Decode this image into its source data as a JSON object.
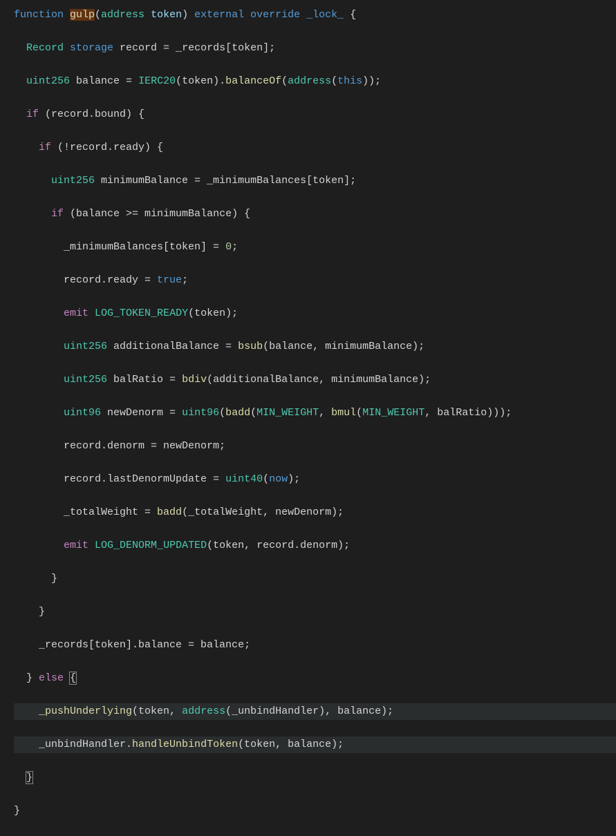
{
  "code": {
    "lines": [
      {
        "indent": 0,
        "tokens": [
          {
            "t": "function ",
            "c": "keyword"
          },
          {
            "t": "gulp",
            "c": "fn-name highlighted"
          },
          {
            "t": "(",
            "c": "paren"
          },
          {
            "t": "address",
            "c": "type"
          },
          {
            "t": " ",
            "c": ""
          },
          {
            "t": "token",
            "c": "variable"
          },
          {
            "t": ") ",
            "c": "paren"
          },
          {
            "t": "external",
            "c": "keyword"
          },
          {
            "t": " ",
            "c": ""
          },
          {
            "t": "override",
            "c": "keyword"
          },
          {
            "t": " ",
            "c": ""
          },
          {
            "t": "_lock_",
            "c": "modifier"
          },
          {
            "t": " {",
            "c": "brace"
          }
        ]
      },
      {
        "indent": 1,
        "tokens": [
          {
            "t": "Record ",
            "c": "type"
          },
          {
            "t": "storage",
            "c": "storage"
          },
          {
            "t": " record = _records[token];",
            "c": "operator"
          }
        ]
      },
      {
        "indent": 1,
        "tokens": [
          {
            "t": "uint256",
            "c": "type"
          },
          {
            "t": " balance = ",
            "c": "operator"
          },
          {
            "t": "IERC20",
            "c": "type"
          },
          {
            "t": "(token).",
            "c": "punct"
          },
          {
            "t": "balanceOf",
            "c": "member"
          },
          {
            "t": "(",
            "c": "paren"
          },
          {
            "t": "address",
            "c": "type"
          },
          {
            "t": "(",
            "c": "paren"
          },
          {
            "t": "this",
            "c": "keyword"
          },
          {
            "t": "));",
            "c": "punct"
          }
        ]
      },
      {
        "indent": 1,
        "tokens": [
          {
            "t": "if",
            "c": "control"
          },
          {
            "t": " (record.bound) {",
            "c": "punct"
          }
        ]
      },
      {
        "indent": 2,
        "tokens": [
          {
            "t": "if",
            "c": "control"
          },
          {
            "t": " (!record.ready) {",
            "c": "punct"
          }
        ]
      },
      {
        "indent": 3,
        "tokens": [
          {
            "t": "uint256",
            "c": "type"
          },
          {
            "t": " minimumBalance = _minimumBalances[token];",
            "c": "operator"
          }
        ]
      },
      {
        "indent": 3,
        "tokens": [
          {
            "t": "if",
            "c": "control"
          },
          {
            "t": " (balance >= minimumBalance) {",
            "c": "punct"
          }
        ]
      },
      {
        "indent": 4,
        "tokens": [
          {
            "t": "_minimumBalances[token] = ",
            "c": "operator"
          },
          {
            "t": "0",
            "c": "number"
          },
          {
            "t": ";",
            "c": "punct"
          }
        ]
      },
      {
        "indent": 4,
        "tokens": [
          {
            "t": "record.ready = ",
            "c": "operator"
          },
          {
            "t": "true",
            "c": "constant"
          },
          {
            "t": ";",
            "c": "punct"
          }
        ]
      },
      {
        "indent": 4,
        "tokens": [
          {
            "t": "emit",
            "c": "control"
          },
          {
            "t": " ",
            "c": ""
          },
          {
            "t": "LOG_TOKEN_READY",
            "c": "type"
          },
          {
            "t": "(token);",
            "c": "punct"
          }
        ]
      },
      {
        "indent": 4,
        "tokens": [
          {
            "t": "uint256",
            "c": "type"
          },
          {
            "t": " additionalBalance = ",
            "c": "operator"
          },
          {
            "t": "bsub",
            "c": "member"
          },
          {
            "t": "(balance, minimumBalance);",
            "c": "punct"
          }
        ]
      },
      {
        "indent": 4,
        "tokens": [
          {
            "t": "uint256",
            "c": "type"
          },
          {
            "t": " balRatio = ",
            "c": "operator"
          },
          {
            "t": "bdiv",
            "c": "member"
          },
          {
            "t": "(additionalBalance, minimumBalance);",
            "c": "punct"
          }
        ]
      },
      {
        "indent": 4,
        "tokens": [
          {
            "t": "uint96",
            "c": "type"
          },
          {
            "t": " newDenorm = ",
            "c": "operator"
          },
          {
            "t": "uint96",
            "c": "type"
          },
          {
            "t": "(",
            "c": "paren"
          },
          {
            "t": "badd",
            "c": "member"
          },
          {
            "t": "(",
            "c": "paren"
          },
          {
            "t": "MIN_WEIGHT",
            "c": "type"
          },
          {
            "t": ", ",
            "c": "punct"
          },
          {
            "t": "bmul",
            "c": "member"
          },
          {
            "t": "(",
            "c": "paren"
          },
          {
            "t": "MIN_WEIGHT",
            "c": "type"
          },
          {
            "t": ", balRatio)));",
            "c": "punct"
          }
        ]
      },
      {
        "indent": 4,
        "tokens": [
          {
            "t": "record.denorm = newDenorm;",
            "c": "operator"
          }
        ]
      },
      {
        "indent": 4,
        "tokens": [
          {
            "t": "record.lastDenormUpdate = ",
            "c": "operator"
          },
          {
            "t": "uint40",
            "c": "type"
          },
          {
            "t": "(",
            "c": "paren"
          },
          {
            "t": "now",
            "c": "keyword"
          },
          {
            "t": ");",
            "c": "punct"
          }
        ]
      },
      {
        "indent": 4,
        "tokens": [
          {
            "t": "_totalWeight = ",
            "c": "operator"
          },
          {
            "t": "badd",
            "c": "member"
          },
          {
            "t": "(_totalWeight, newDenorm);",
            "c": "punct"
          }
        ]
      },
      {
        "indent": 4,
        "tokens": [
          {
            "t": "emit",
            "c": "control"
          },
          {
            "t": " ",
            "c": ""
          },
          {
            "t": "LOG_DENORM_UPDATED",
            "c": "type"
          },
          {
            "t": "(token, record.denorm);",
            "c": "punct"
          }
        ]
      },
      {
        "indent": 3,
        "tokens": [
          {
            "t": "}",
            "c": "brace"
          }
        ]
      },
      {
        "indent": 2,
        "tokens": [
          {
            "t": "}",
            "c": "brace"
          }
        ]
      },
      {
        "indent": 2,
        "tokens": [
          {
            "t": "_records[token].balance = balance;",
            "c": "operator"
          }
        ]
      },
      {
        "indent": 1,
        "tokens": [
          {
            "t": "} ",
            "c": "brace"
          },
          {
            "t": "else",
            "c": "control"
          },
          {
            "t": " ",
            "c": ""
          },
          {
            "t": "{",
            "c": "brace brace-match"
          }
        ]
      },
      {
        "indent": 2,
        "highlighted": true,
        "tokens": [
          {
            "t": "_pushUnderlying",
            "c": "member"
          },
          {
            "t": "(token, ",
            "c": "punct"
          },
          {
            "t": "address",
            "c": "type"
          },
          {
            "t": "(_unbindHandler), balance);",
            "c": "punct"
          }
        ]
      },
      {
        "indent": 2,
        "highlighted": true,
        "tokens": [
          {
            "t": "_unbindHandler.",
            "c": "operator"
          },
          {
            "t": "handleUnbindToken",
            "c": "member"
          },
          {
            "t": "(token, balance);",
            "c": "punct"
          }
        ]
      },
      {
        "indent": 1,
        "tokens": [
          {
            "t": "}",
            "c": "brace brace-match"
          }
        ]
      },
      {
        "indent": 0,
        "tokens": [
          {
            "t": "}",
            "c": "brace"
          }
        ]
      }
    ]
  }
}
